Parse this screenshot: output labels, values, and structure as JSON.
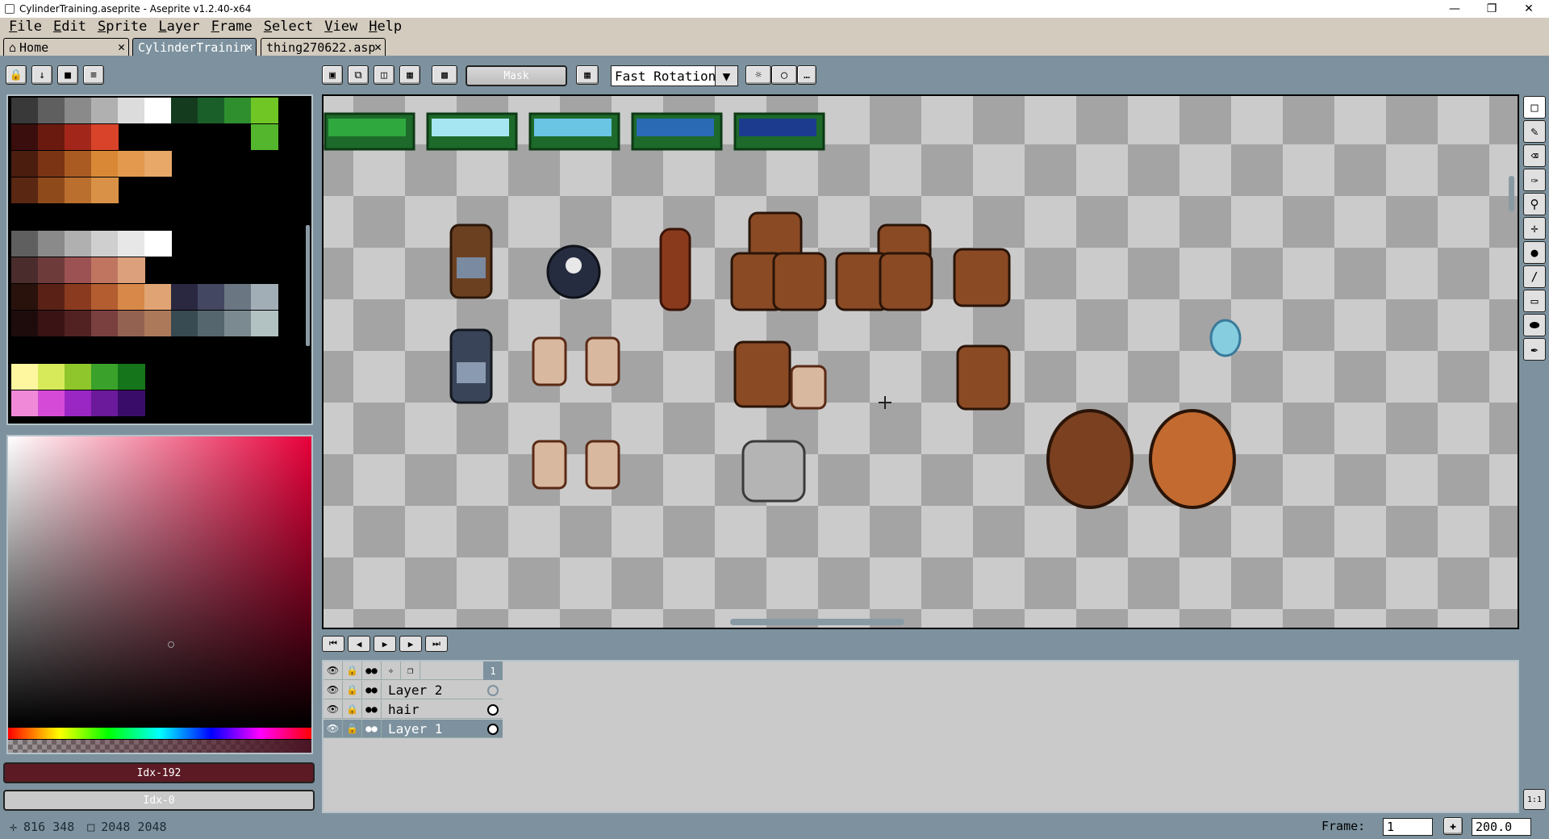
{
  "window": {
    "title": "CylinderTraining.aseprite - Aseprite v1.2.40-x64"
  },
  "menu": [
    "File",
    "Edit",
    "Sprite",
    "Layer",
    "Frame",
    "Select",
    "View",
    "Help"
  ],
  "tabs": [
    {
      "label": "Home"
    },
    {
      "label": "CylinderTrainin"
    },
    {
      "label": "thing270622.asp"
    }
  ],
  "toolbar": {
    "mask_label": "Mask",
    "rotation_algorithm": "Fast Rotation"
  },
  "palette": {
    "swatches": [
      [
        "#393939",
        "#5f5f5f",
        "#8a8a8a",
        "#b0b0b0",
        "#dcdcdc",
        "#ffffff",
        "#153b1f",
        "#1a5f2a",
        "#2f8f2f",
        "#6fc625"
      ],
      [
        "#3a0e0c",
        "#6a1a0f",
        "#a2271a",
        "#d9432a",
        "",
        "",
        "",
        "",
        "",
        "#54b62c"
      ],
      [
        "#4a1d0e",
        "#7b3514",
        "#a95b21",
        "#d98935",
        "#e39a4e",
        "#e7a868",
        "",
        "",
        "",
        ""
      ],
      [
        "#5a2712",
        "#8f4a1c",
        "#ba6f2e",
        "#d99147",
        "",
        "",
        "",
        "",
        "",
        ""
      ],
      [],
      [
        "#5f5f5f",
        "#8a8a8a",
        "#b0b0b0",
        "#cfcfcf",
        "#e7e7e7",
        "#ffffff",
        "",
        "",
        "",
        ""
      ],
      [
        "#4a2c2c",
        "#6e3b3b",
        "#9c5252",
        "#c07561",
        "#dca07d",
        "",
        "",
        "",
        "",
        ""
      ],
      [
        "#2a120c",
        "#5a2216",
        "#8a3a1e",
        "#b35d31",
        "#d88848",
        "#e0a474",
        "#2a2840",
        "#434762",
        "#6a7682",
        "#a2aeb6"
      ],
      [
        "#1e0c0c",
        "#3a1414",
        "#522222",
        "#7a3f3f",
        "#946250",
        "#ac7a5a",
        "#384a52",
        "#56666e",
        "#7b8a90",
        "#b2c2c2"
      ],
      [],
      [
        "#fff6a0",
        "#d7ea5a",
        "#8ec62c",
        "#3aa22a",
        "#15751a",
        "",
        "",
        "",
        "",
        ""
      ],
      [
        "#f08ad8",
        "#d64ad8",
        "#9a26c4",
        "#6a1a9a",
        "#3a0c6a",
        "",
        "",
        "",
        "",
        ""
      ]
    ]
  },
  "colors": {
    "foreground_label": "Idx-192",
    "background_label": "Idx-0",
    "foreground_hex": "#5c1a24",
    "background_hex": "#c9c9c9"
  },
  "status": {
    "cursor_pos": "816 348",
    "sprite_size": "2048 2048"
  },
  "frame": {
    "label": "Frame:",
    "value": "1",
    "zoom": "200.0"
  },
  "timeline": {
    "frame_header": "1",
    "layers": [
      {
        "name": "Layer 2",
        "selected": false
      },
      {
        "name": "hair",
        "selected": false
      },
      {
        "name": "Layer 1",
        "selected": true
      }
    ]
  },
  "zoom_button": "1:1"
}
